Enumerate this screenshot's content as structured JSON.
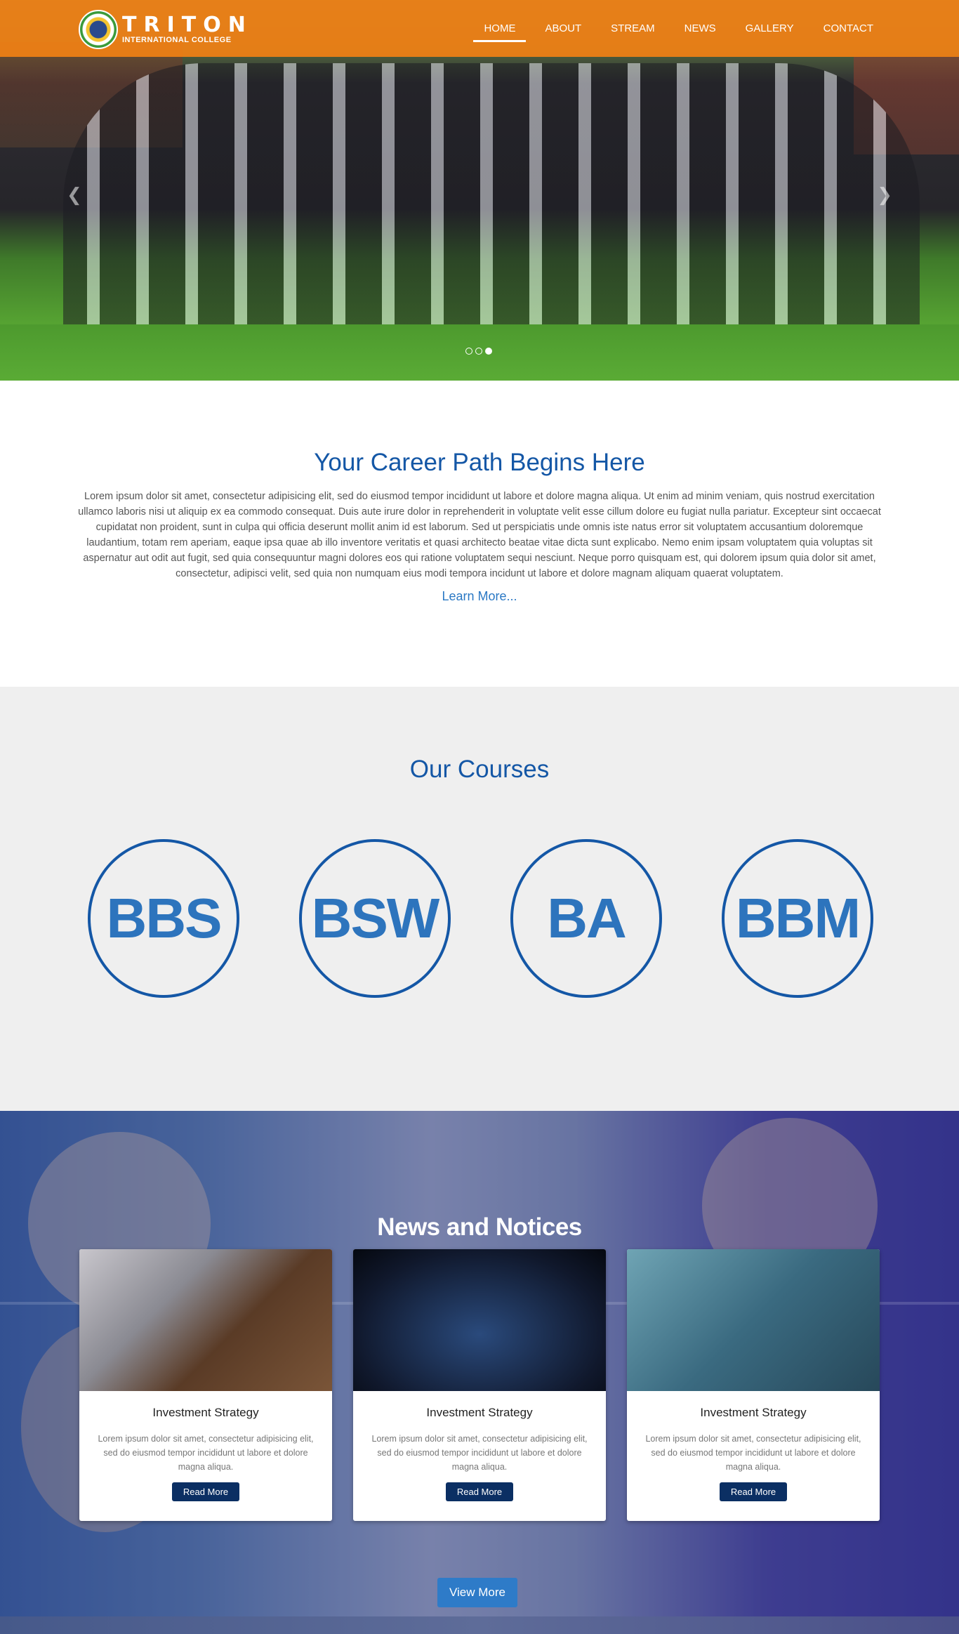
{
  "brand": {
    "name": "TRITON",
    "subtitle": "INTERNATIONAL COLLEGE",
    "primary_color": "#f08014",
    "accent_color": "#1457a6"
  },
  "nav": {
    "items": [
      {
        "label": "HOME",
        "active": true
      },
      {
        "label": "ABOUT"
      },
      {
        "label": "STREAM"
      },
      {
        "label": "NEWS"
      },
      {
        "label": "GALLERY"
      },
      {
        "label": "CONTACT"
      }
    ]
  },
  "hero": {
    "prev_icon": "chevron-left-icon",
    "next_icon": "chevron-right-icon",
    "prev_glyph": "❮",
    "next_glyph": "❯",
    "slides_total": 3,
    "slide_active": 3
  },
  "career": {
    "title": "Your Career Path Begins Here",
    "body": "Lorem ipsum dolor sit amet, consectetur adipisicing elit, sed do eiusmod tempor incididunt ut labore et dolore magna aliqua. Ut enim ad minim veniam, quis nostrud exercitation ullamco laboris nisi ut aliquip ex ea commodo consequat. Duis aute irure dolor in reprehenderit in voluptate velit esse cillum dolore eu fugiat nulla pariatur. Excepteur sint occaecat cupidatat non proident, sunt in culpa qui officia deserunt mollit anim id est laborum. Sed ut perspiciatis unde omnis iste natus error sit voluptatem accusantium doloremque laudantium, totam rem aperiam, eaque ipsa quae ab illo inventore veritatis et quasi architecto beatae vitae dicta sunt explicabo. Nemo enim ipsam voluptatem quia voluptas sit aspernatur aut odit aut fugit, sed quia consequuntur magni dolores eos qui ratione voluptatem sequi nesciunt. Neque porro quisquam est, qui dolorem ipsum quia dolor sit amet, consectetur, adipisci velit, sed quia non numquam eius modi tempora incidunt ut labore et dolore magnam aliquam quaerat voluptatem.",
    "link": "Learn More..."
  },
  "courses": {
    "title": "Our Courses",
    "items": [
      "BBS",
      "BSW",
      "BA",
      "BBM"
    ]
  },
  "news": {
    "title": "News and Notices",
    "cards": [
      {
        "title": "Investment Strategy",
        "text": "Lorem ipsum dolor sit amet, consectetur adipisicing elit, sed do eiusmod tempor incididunt ut labore et dolore magna aliqua.",
        "button": "Read More"
      },
      {
        "title": "Investment Strategy",
        "text": "Lorem ipsum dolor sit amet, consectetur adipisicing elit, sed do eiusmod tempor incididunt ut labore et dolore magna aliqua.",
        "button": "Read More"
      },
      {
        "title": "Investment Strategy",
        "text": "Lorem ipsum dolor sit amet, consectetur adipisicing elit, sed do eiusmod tempor incididunt ut labore et dolore magna aliqua.",
        "button": "Read More"
      }
    ],
    "view_more": "View More"
  }
}
